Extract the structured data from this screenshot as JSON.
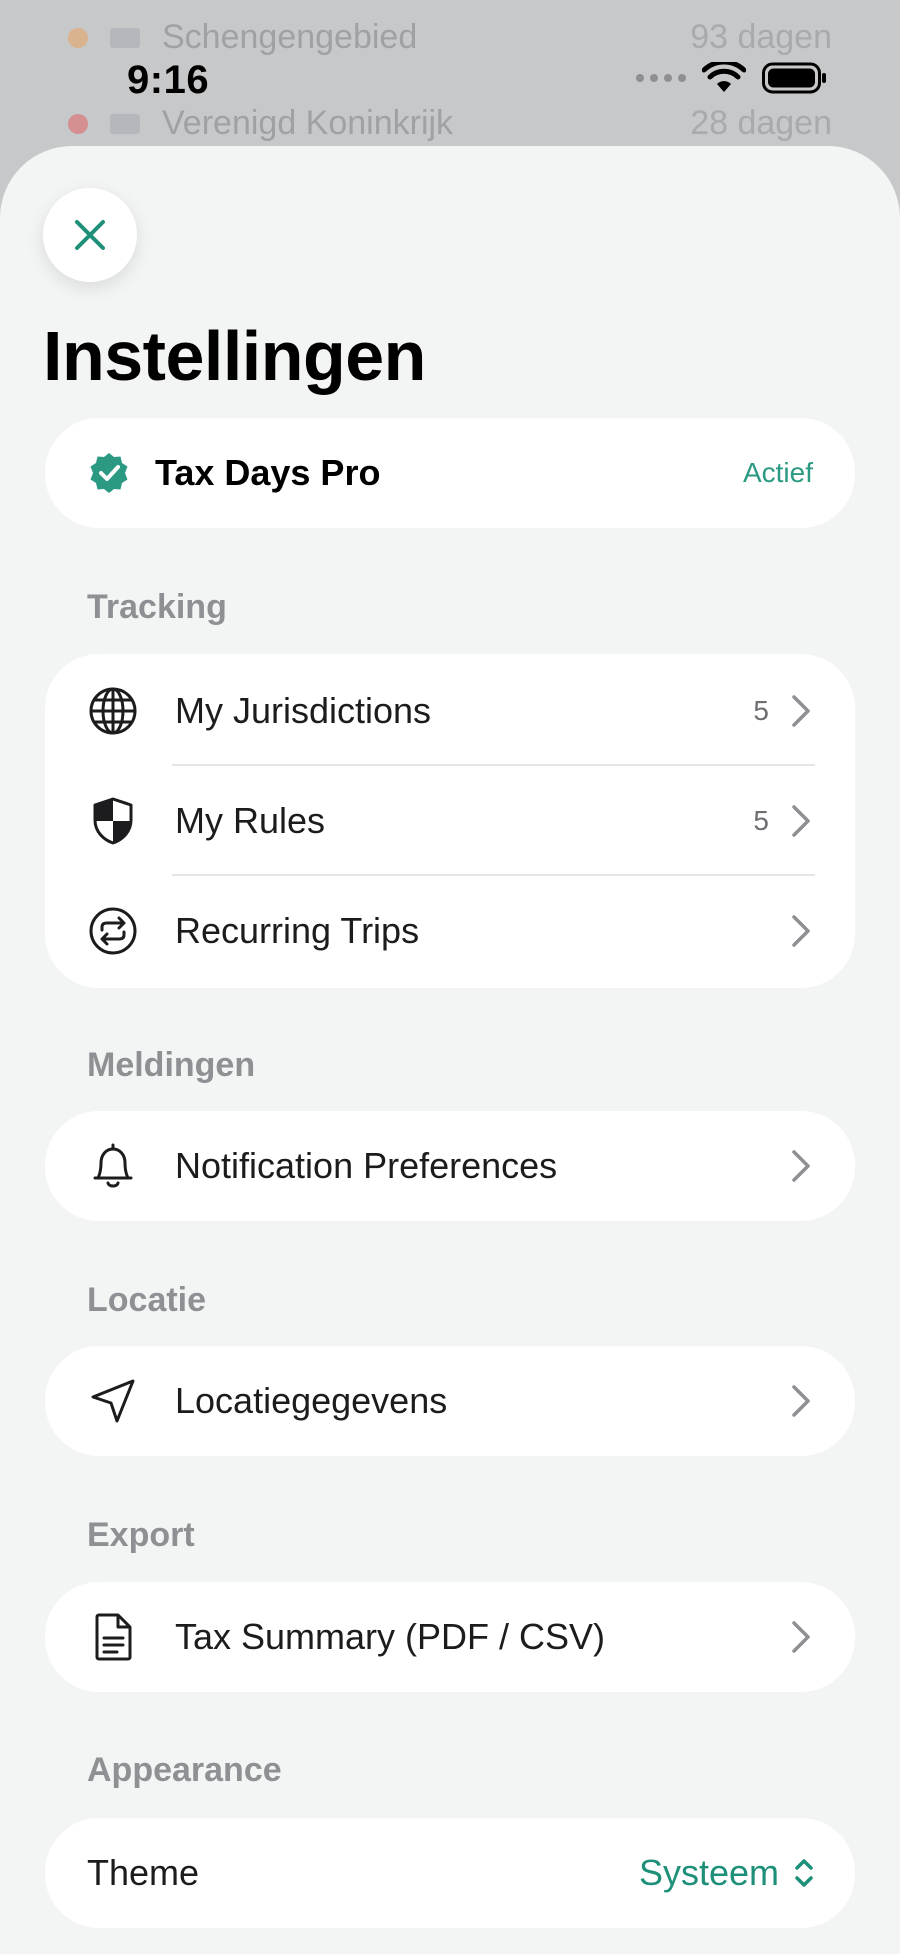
{
  "status_bar": {
    "time": "9:16"
  },
  "background_list": [
    {
      "name": "Schengengebied",
      "days": "93 dagen",
      "dot_color": "#e8a15c"
    },
    {
      "name": "Verenigd Koninkrijk",
      "days": "28 dagen",
      "dot_color": "#e06060"
    }
  ],
  "page": {
    "title": "Instellingen"
  },
  "subscription": {
    "name": "Tax Days Pro",
    "status": "Actief",
    "icon": "verified-badge-icon"
  },
  "sections": {
    "tracking": {
      "label": "Tracking",
      "items": [
        {
          "label": "My Jurisdictions",
          "count": "5",
          "icon": "globe-icon"
        },
        {
          "label": "My Rules",
          "count": "5",
          "icon": "shield-icon"
        },
        {
          "label": "Recurring Trips",
          "count": "",
          "icon": "repeat-icon"
        }
      ]
    },
    "notifications": {
      "label": "Meldingen",
      "items": [
        {
          "label": "Notification Preferences",
          "icon": "bell-icon"
        }
      ]
    },
    "location": {
      "label": "Locatie",
      "items": [
        {
          "label": "Locatiegegevens",
          "icon": "location-arrow-icon"
        }
      ]
    },
    "export": {
      "label": "Export",
      "items": [
        {
          "label": "Tax Summary (PDF / CSV)",
          "icon": "document-icon"
        }
      ]
    },
    "appearance": {
      "label": "Appearance",
      "theme": {
        "label": "Theme",
        "value": "Systeem"
      }
    }
  },
  "colors": {
    "accent": "#1e8f78",
    "sheet_background": "#f3f4f4",
    "card": "#ffffff"
  }
}
